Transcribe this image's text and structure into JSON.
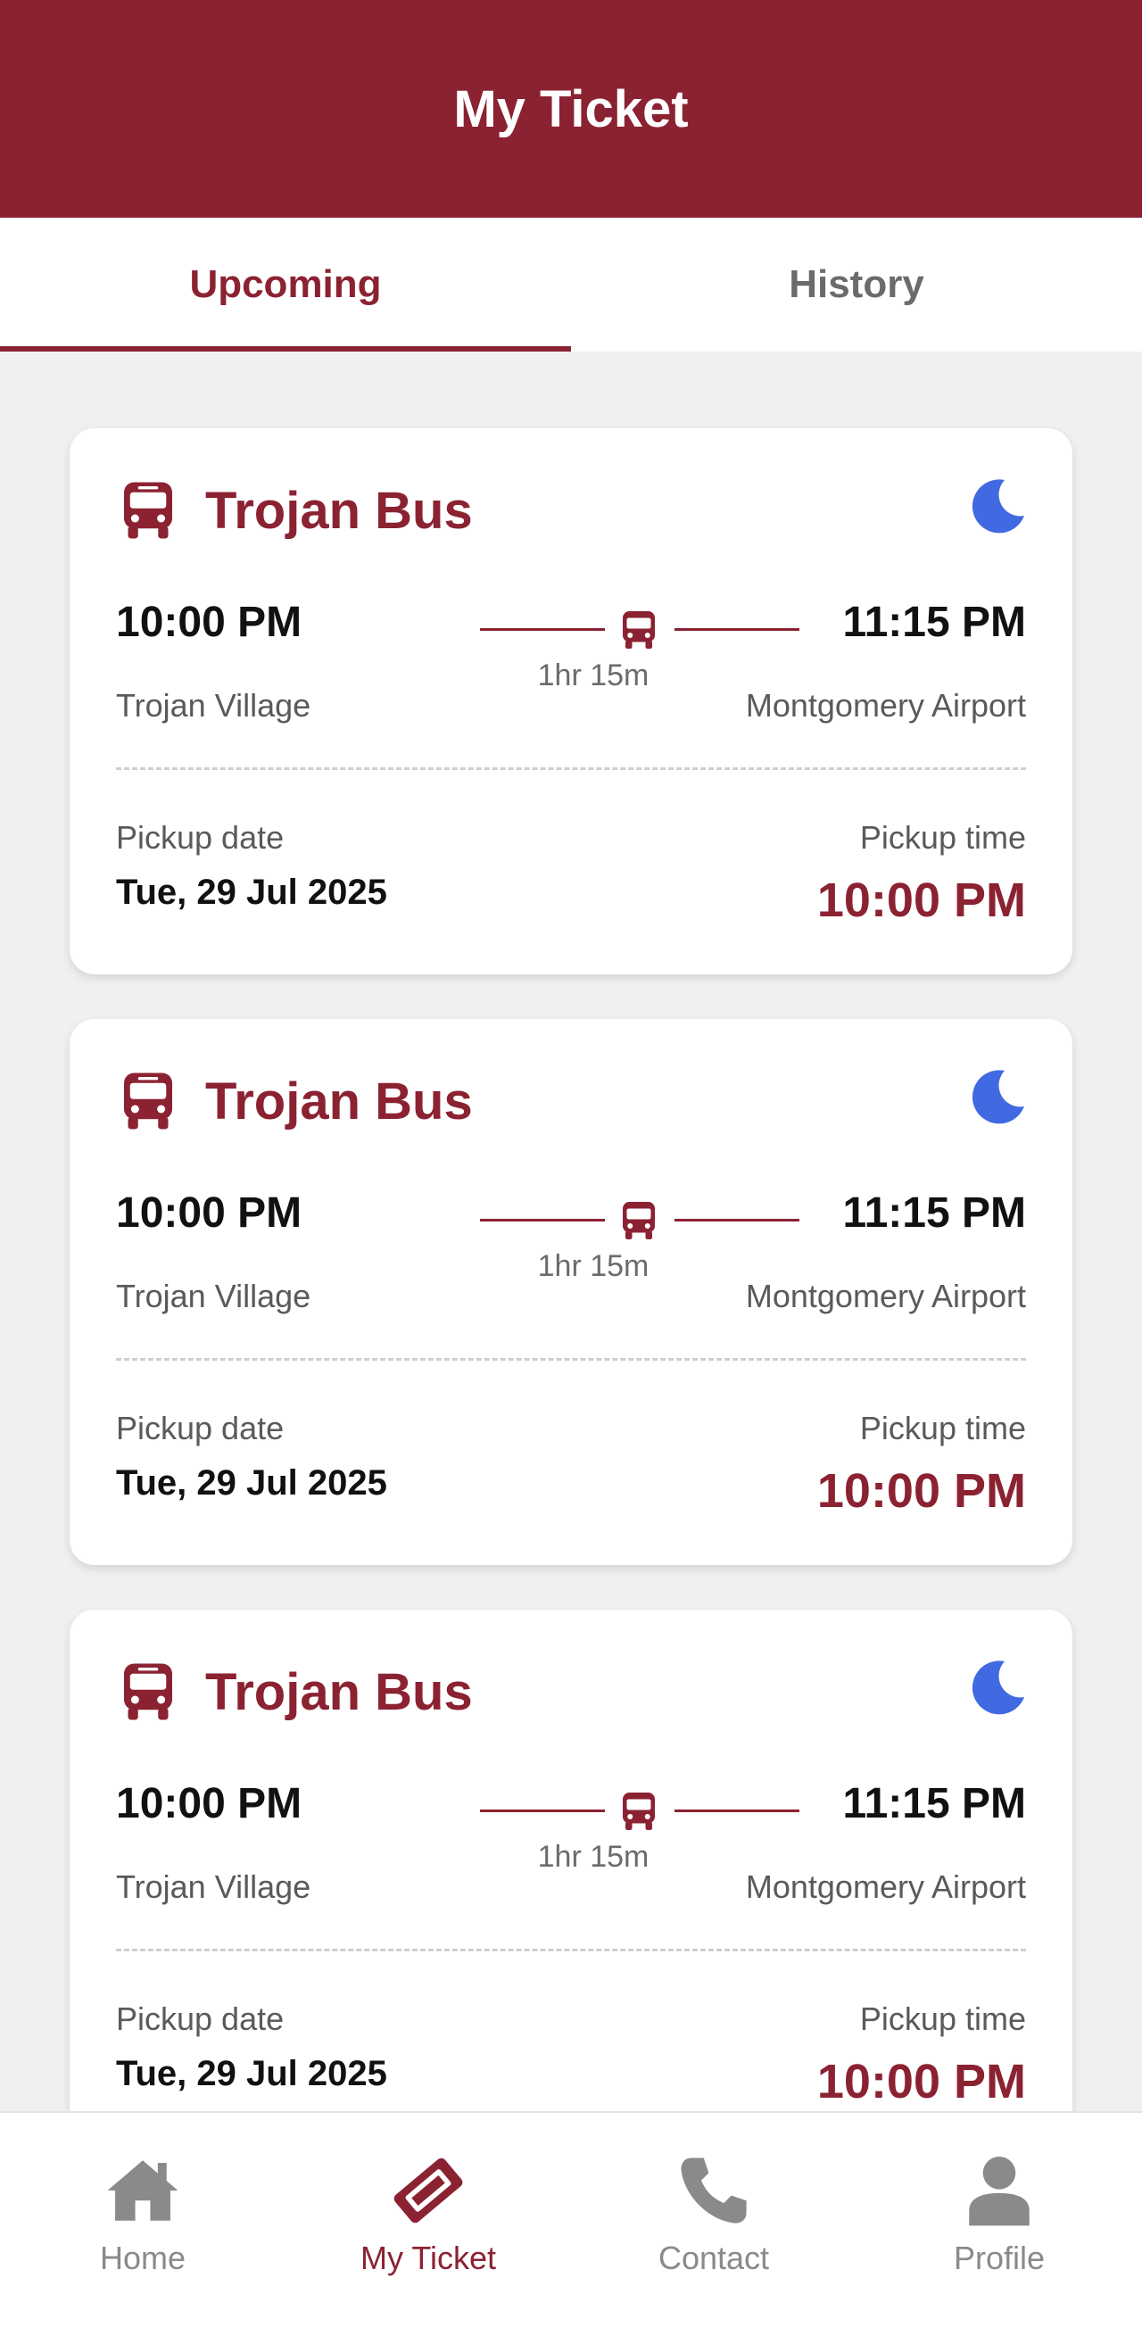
{
  "header": {
    "title": "My Ticket"
  },
  "tabs": [
    {
      "label": "Upcoming",
      "active": true
    },
    {
      "label": "History",
      "active": false
    }
  ],
  "tickets": [
    {
      "operator": "Trojan Bus",
      "departure_time": "10:00 PM",
      "arrival_time": "11:15 PM",
      "duration": "1hr 15m",
      "from": "Trojan Village",
      "to": "Montgomery Airport",
      "pickup_date_label": "Pickup date",
      "pickup_date": "Tue, 29 Jul 2025",
      "pickup_time_label": "Pickup time",
      "pickup_time": "10:00 PM",
      "time_of_day_icon": "moon-icon"
    },
    {
      "operator": "Trojan Bus",
      "departure_time": "10:00 PM",
      "arrival_time": "11:15 PM",
      "duration": "1hr 15m",
      "from": "Trojan Village",
      "to": "Montgomery Airport",
      "pickup_date_label": "Pickup date",
      "pickup_date": "Tue, 29 Jul 2025",
      "pickup_time_label": "Pickup time",
      "pickup_time": "10:00 PM",
      "time_of_day_icon": "moon-icon"
    },
    {
      "operator": "Trojan Bus",
      "departure_time": "10:00 PM",
      "arrival_time": "11:15 PM",
      "duration": "1hr 15m",
      "from": "Trojan Village",
      "to": "Montgomery Airport",
      "pickup_date_label": "Pickup date",
      "pickup_date": "Tue, 29 Jul 2025",
      "pickup_time_label": "Pickup time",
      "pickup_time": "10:00 PM",
      "time_of_day_icon": "moon-icon"
    }
  ],
  "bottom_nav": [
    {
      "label": "Home",
      "icon": "home-icon",
      "active": false
    },
    {
      "label": "My Ticket",
      "icon": "ticket-icon",
      "active": true
    },
    {
      "label": "Contact",
      "icon": "phone-icon",
      "active": false
    },
    {
      "label": "Profile",
      "icon": "user-icon",
      "active": false
    }
  ],
  "colors": {
    "brand": "#8b2232",
    "moon": "#4169e1",
    "inactive": "#8a8a8a",
    "background": "#f0f0f0"
  }
}
